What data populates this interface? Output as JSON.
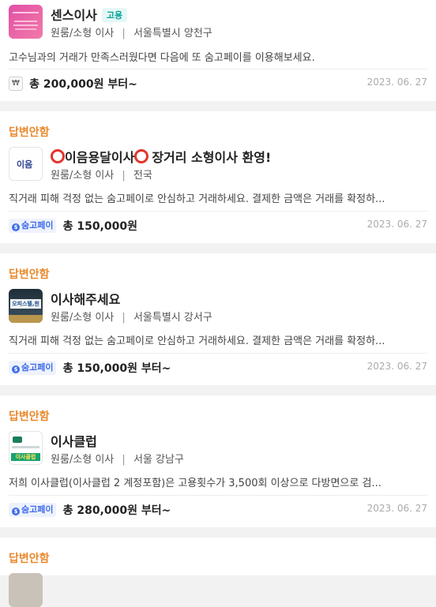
{
  "cards": [
    {
      "name": "센스이사",
      "badge": "고용",
      "category": "원룸/소형 이사",
      "location": "서울특별시 양천구",
      "message": "고수님과의 거래가 만족스러웠다면 다음에 또 숨고페이를 이용해보세요.",
      "price": "총 200,000원 부터~",
      "date": "2023. 06. 27",
      "won_symbol": "₩",
      "colors": {
        "thumb": "#d84fb4"
      }
    },
    {
      "status": "답변안함",
      "name": "이음용달이사",
      "name_suffix": "장거리 소형이사 환영!",
      "category": "원룸/소형 이사",
      "location": "전국",
      "message": "직거래 피해 걱정 없는 숨고페이로 안심하고 거래하세요. 결제한 금액은 거래를 확정하...",
      "pay_label": "숨고페이",
      "price": "총 150,000원",
      "date": "2023. 06. 27",
      "thumb_text": "이음",
      "colors": {
        "thumb": "#ffffff"
      }
    },
    {
      "status": "답변안함",
      "name": "이사해주세요",
      "category": "원룸/소형 이사",
      "location": "서울특별시 강서구",
      "message": "직거래 피해 걱정 없는 숨고페이로 안심하고 거래하세요. 결제한 금액은 거래를 확정하...",
      "pay_label": "숨고페이",
      "price": "총 150,000원 부터~",
      "date": "2023. 06. 27",
      "thumb_text": "오피스텔,원룸",
      "colors": {
        "thumb": "#2b3a44"
      }
    },
    {
      "status": "답변안함",
      "name": "이사클럽",
      "category": "원룸/소형 이사",
      "location": "서울 강남구",
      "message": "저희 이사클럽(이사클럽 2 계정포함)은 고용횟수가 3,500회 이상으로 다방면으로 검...",
      "pay_label": "숨고페이",
      "price": "총 280,000원 부터~",
      "date": "2023. 06. 27",
      "thumb_text": "이사클럽",
      "colors": {
        "thumb": "#18a36f"
      }
    },
    {
      "status": "답변안함"
    }
  ],
  "separator": "|",
  "colors": {
    "status": "#e9892d",
    "accent_blue": "#3e6ce8",
    "badge_teal": "#00a39a"
  }
}
